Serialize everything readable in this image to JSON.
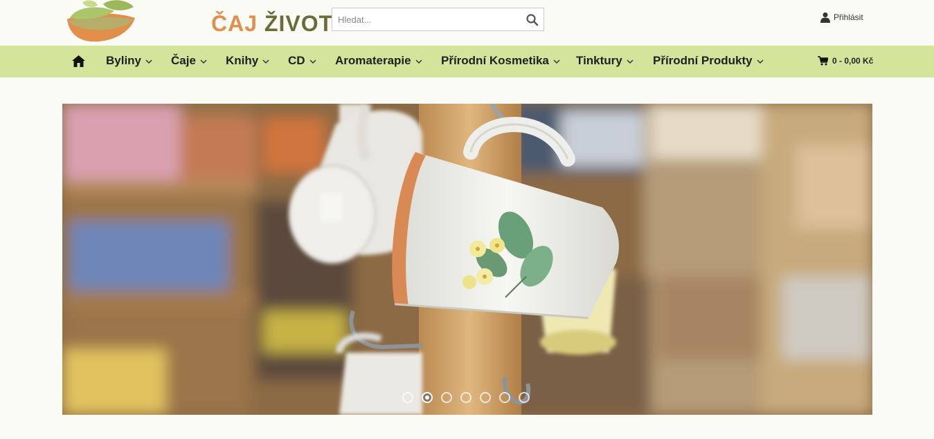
{
  "brand": {
    "word1": "ČAJ",
    "word2": "ŽIVOTA"
  },
  "search": {
    "placeholder": "Hledat..."
  },
  "account": {
    "login_label": "Přihlásit"
  },
  "nav": {
    "items": [
      {
        "label": "Byliny"
      },
      {
        "label": "Čaje"
      },
      {
        "label": "Knihy"
      },
      {
        "label": "CD"
      },
      {
        "label": "Aromaterapie"
      },
      {
        "label": "Přírodní Kosmetika"
      },
      {
        "label": "Tinktury"
      },
      {
        "label": "Přírodní Produkty"
      }
    ]
  },
  "cart": {
    "summary": "0 - 0,00 Kč"
  },
  "slider": {
    "slide_count": 7,
    "active_index": 1
  },
  "colors": {
    "nav_bg": "#d4e49b",
    "brand_orange": "#e28f4c",
    "brand_olive": "#6a6d3a",
    "page_bg": "#fbfbf6"
  }
}
